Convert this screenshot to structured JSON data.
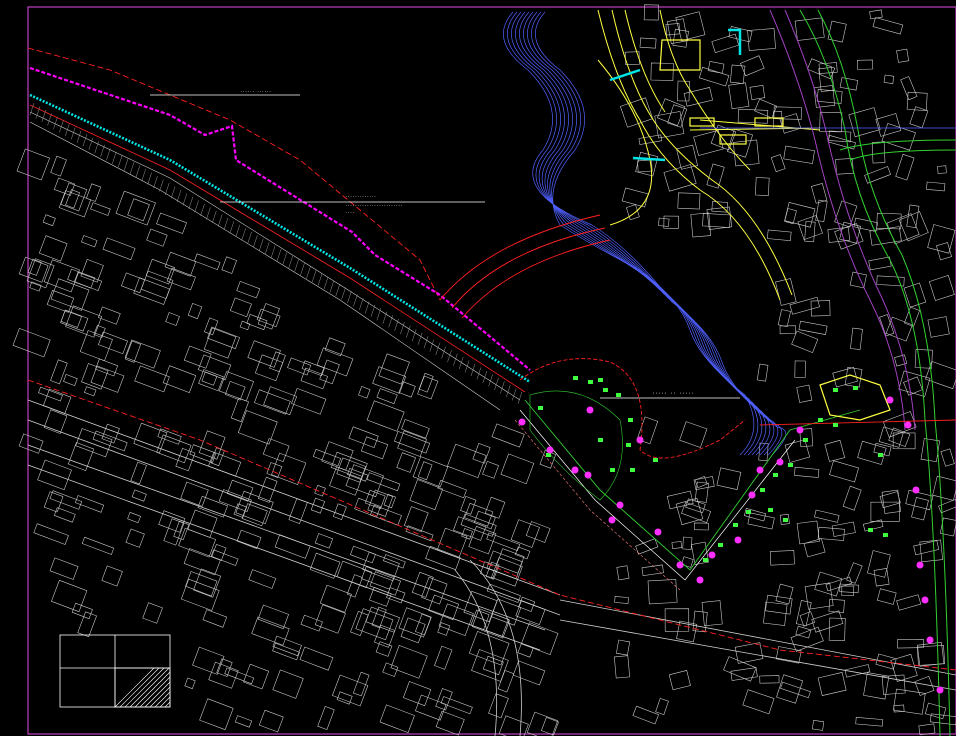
{
  "drawing": {
    "background": "#000000",
    "frame_color": "#c040c0",
    "colors": {
      "parcel": "#c8c8c8",
      "boundary_red": "#ff2020",
      "promenade_magenta": "#ff00ff",
      "promenade_cyan": "#00e5e5",
      "contour_blue": "#5060ff",
      "road_yellow": "#ffff40",
      "road_green": "#30d030",
      "road_purple": "#a040c0",
      "marker_green": "#40ff40",
      "marker_magenta": "#ff30ff"
    },
    "labels": {
      "upper_north": "······ ······",
      "upper_mid_line1": "·············",
      "upper_mid_line2": "························",
      "upper_mid_line3": "····",
      "bay_label": "····· ·· ·····"
    },
    "markers": {
      "green_count": 30,
      "magenta_count": 24
    }
  }
}
